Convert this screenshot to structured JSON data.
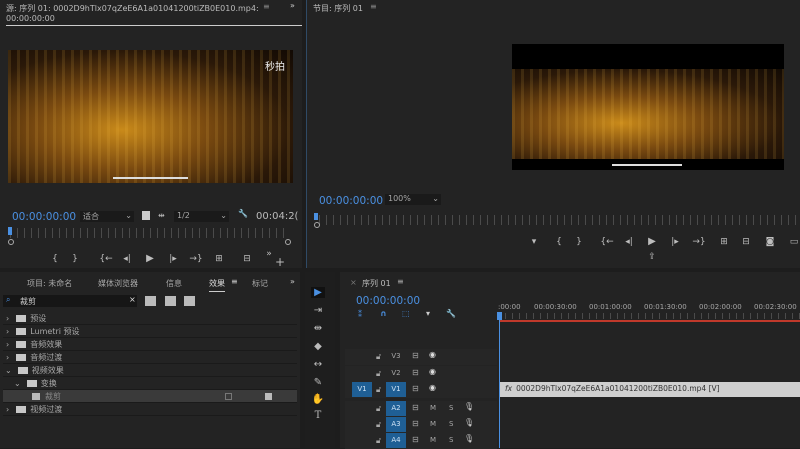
{
  "source": {
    "title": "源: 序列 01: 0002D9hTlx07qZeE6A1a01041200tiZB0E010.mp4: 00:00:00:00",
    "watermark": "秒拍",
    "timecode": "00:00:00:00",
    "fit": "适合",
    "resolution": "1/2",
    "duration": "00:04:2("
  },
  "program": {
    "title": "节目: 序列 01",
    "timecode": "00:00:00:00",
    "zoom": "100%"
  },
  "effects_panel": {
    "tabs": [
      "项目: 未命名",
      "媒体浏览器",
      "信息",
      "效果",
      "标记"
    ],
    "active_tab": "效果",
    "search_value": "裁剪",
    "items": [
      {
        "label": "预设",
        "level": 0,
        "expanded": false
      },
      {
        "label": "Lumetri 预设",
        "level": 0,
        "expanded": false
      },
      {
        "label": "音频效果",
        "level": 0,
        "expanded": false
      },
      {
        "label": "音频过渡",
        "level": 0,
        "expanded": false
      },
      {
        "label": "视频效果",
        "level": 0,
        "expanded": true
      },
      {
        "label": "变换",
        "level": 1,
        "expanded": true
      },
      {
        "label": "裁剪",
        "level": 2,
        "selected": true
      },
      {
        "label": "视频过渡",
        "level": 0,
        "expanded": false
      }
    ]
  },
  "timeline": {
    "title": "序列 01",
    "timecode": "00:00:00:00",
    "ruler": [
      ":00:00",
      "00:00:30:00",
      "00:01:00:00",
      "00:01:30:00",
      "00:02:00:00",
      "00:02:30:00"
    ],
    "tracks": [
      {
        "name": "V3",
        "type": "video"
      },
      {
        "name": "V2",
        "type": "video"
      },
      {
        "name": "V1",
        "type": "video",
        "source": "V1"
      },
      {
        "name": "A2",
        "type": "audio"
      },
      {
        "name": "A3",
        "type": "audio"
      },
      {
        "name": "A4",
        "type": "audio"
      }
    ],
    "clip": "0002D9hTlx07qZeE6A1a01041200tiZB0E010.mp4 [V]",
    "mute": "M",
    "solo": "S",
    "fx": "fx"
  },
  "colors": {
    "accent": "#4a90e2",
    "render_bar": "#c0392b",
    "selected_track": "#1f5f95"
  }
}
